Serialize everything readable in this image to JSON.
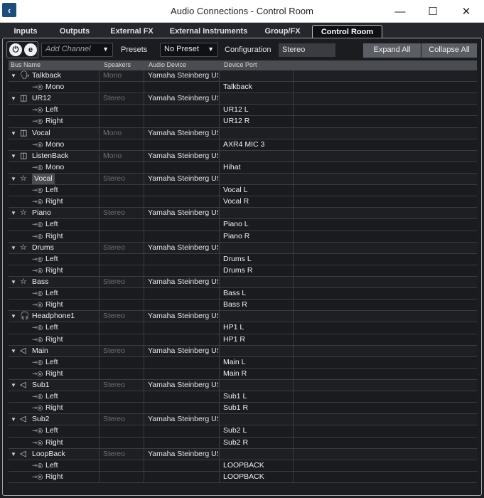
{
  "window": {
    "title": "Audio Connections - Control Room",
    "minimize_glyph": "—",
    "maximize_glyph": "☐",
    "close_glyph": "✕",
    "app_icon_glyph": "‹"
  },
  "tabs": [
    "Inputs",
    "Outputs",
    "External FX",
    "External Instruments",
    "Group/FX",
    "Control Room"
  ],
  "active_tab": "Control Room",
  "toolbar": {
    "power_glyph": "⏻",
    "e_glyph": "e",
    "add_channel": "Add Channel",
    "presets_label": "Presets",
    "preset_value": "No Preset",
    "configuration_label": "Configuration",
    "configuration_value": "Stereo",
    "expand_all": "Expand All",
    "collapse_all": "Collapse All",
    "dropdown_arrow": "▼"
  },
  "columns": [
    "Bus Name",
    "Speakers",
    "Audio Device",
    "Device Port"
  ],
  "rows": [
    {
      "type": "bus",
      "icon": "talkback-icon",
      "glyph": "🗣",
      "name": "Talkback",
      "speakers": "Mono",
      "device": "Yamaha Steinberg USB ASIO",
      "port": ""
    },
    {
      "type": "ch",
      "name": "Mono",
      "port": "Talkback"
    },
    {
      "type": "bus",
      "icon": "monitor-icon",
      "glyph": "◫",
      "name": "UR12",
      "speakers": "Stereo",
      "device": "Yamaha Steinberg USB ASIO",
      "port": ""
    },
    {
      "type": "ch",
      "name": "Left",
      "port": "UR12 L"
    },
    {
      "type": "ch",
      "name": "Right",
      "port": "UR12 R"
    },
    {
      "type": "bus",
      "icon": "monitor-icon",
      "glyph": "◫",
      "name": "Vocal",
      "speakers": "Mono",
      "device": "Yamaha Steinberg USB ASIO",
      "port": ""
    },
    {
      "type": "ch",
      "name": "Mono",
      "port": "AXR4 MIC 3"
    },
    {
      "type": "bus",
      "icon": "monitor-icon",
      "glyph": "◫",
      "name": "ListenBack",
      "speakers": "Mono",
      "device": "Yamaha Steinberg USB ASIO",
      "port": ""
    },
    {
      "type": "ch",
      "name": "Mono",
      "port": "Hihat"
    },
    {
      "type": "bus",
      "icon": "cue-star-icon",
      "glyph": "☆",
      "name": "Vocal",
      "speakers": "Stereo",
      "device": "Yamaha Steinberg USB ASIO",
      "port": "",
      "selected": true
    },
    {
      "type": "ch",
      "name": "Left",
      "port": "Vocal L"
    },
    {
      "type": "ch",
      "name": "Right",
      "port": "Vocal R"
    },
    {
      "type": "bus",
      "icon": "cue-star-icon",
      "glyph": "☆",
      "name": "Piano",
      "speakers": "Stereo",
      "device": "Yamaha Steinberg USB ASIO",
      "port": ""
    },
    {
      "type": "ch",
      "name": "Left",
      "port": "Piano L"
    },
    {
      "type": "ch",
      "name": "Right",
      "port": "Piano R"
    },
    {
      "type": "bus",
      "icon": "cue-star-icon",
      "glyph": "☆",
      "name": "Drums",
      "speakers": "Stereo",
      "device": "Yamaha Steinberg USB ASIO",
      "port": ""
    },
    {
      "type": "ch",
      "name": "Left",
      "port": "Drums L"
    },
    {
      "type": "ch",
      "name": "Right",
      "port": "Drums R"
    },
    {
      "type": "bus",
      "icon": "cue-star-icon",
      "glyph": "☆",
      "name": "Bass",
      "speakers": "Stereo",
      "device": "Yamaha Steinberg USB ASIO",
      "port": ""
    },
    {
      "type": "ch",
      "name": "Left",
      "port": "Bass L"
    },
    {
      "type": "ch",
      "name": "Right",
      "port": "Bass R"
    },
    {
      "type": "bus",
      "icon": "headphone-icon",
      "glyph": "🎧",
      "name": "Headphone1",
      "speakers": "Stereo",
      "device": "Yamaha Steinberg USB ASIO",
      "port": ""
    },
    {
      "type": "ch",
      "name": "Left",
      "port": "HP1 L"
    },
    {
      "type": "ch",
      "name": "Right",
      "port": "HP1 R"
    },
    {
      "type": "bus",
      "icon": "speaker-icon",
      "glyph": "◁",
      "name": "Main",
      "speakers": "Stereo",
      "device": "Yamaha Steinberg USB ASIO",
      "port": ""
    },
    {
      "type": "ch",
      "name": "Left",
      "port": "Main L"
    },
    {
      "type": "ch",
      "name": "Right",
      "port": "Main R"
    },
    {
      "type": "bus",
      "icon": "speaker-icon",
      "glyph": "◁",
      "name": "Sub1",
      "speakers": "Stereo",
      "device": "Yamaha Steinberg USB ASIO",
      "port": ""
    },
    {
      "type": "ch",
      "name": "Left",
      "port": "Sub1 L"
    },
    {
      "type": "ch",
      "name": "Right",
      "port": "Sub1 R"
    },
    {
      "type": "bus",
      "icon": "speaker-icon",
      "glyph": "◁",
      "name": "Sub2",
      "speakers": "Stereo",
      "device": "Yamaha Steinberg USB ASIO",
      "port": ""
    },
    {
      "type": "ch",
      "name": "Left",
      "port": "Sub2 L"
    },
    {
      "type": "ch",
      "name": "Right",
      "port": "Sub2 R"
    },
    {
      "type": "bus",
      "icon": "speaker-icon",
      "glyph": "◁",
      "name": "LoopBack",
      "speakers": "Stereo",
      "device": "Yamaha Steinberg USB ASIO",
      "port": ""
    },
    {
      "type": "ch",
      "name": "Left",
      "port": "LOOPBACK"
    },
    {
      "type": "ch",
      "name": "Right",
      "port": "LOOPBACK"
    }
  ],
  "glyphs": {
    "expand_triangle": "▼",
    "channel_output": "⇾◎"
  },
  "colors": {
    "background": "#1d1e22",
    "header": "#4a4c51",
    "button": "#5b5e64",
    "titlebar": "#ffffff"
  }
}
